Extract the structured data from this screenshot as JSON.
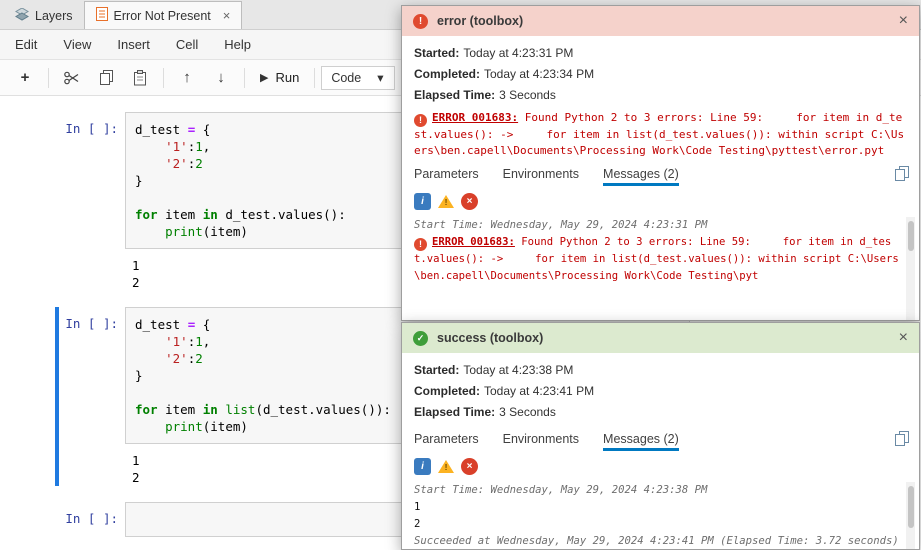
{
  "window": {
    "tabs": [
      {
        "label": "Layers",
        "active": false
      },
      {
        "label": "Error Not Present",
        "active": true
      }
    ]
  },
  "menubar": {
    "items": [
      "Edit",
      "View",
      "Insert",
      "Cell",
      "Help"
    ]
  },
  "toolbar": {
    "add": "+",
    "up": "↑",
    "down": "↓",
    "run_icon": "▶",
    "run_label": "Run",
    "cell_type_value": "Code",
    "caret": "▾"
  },
  "icons": {
    "close": "×",
    "check": "✓",
    "exclamation": "!",
    "info": "i",
    "cross": "×"
  },
  "notebook": {
    "cells": [
      {
        "prompt": "In [ ]:",
        "selected": false,
        "code": [
          [
            [
              "d_test "
            ],
            [
              "=",
              "op"
            ],
            [
              " {"
            ]
          ],
          [
            [
              "    "
            ],
            [
              "'1'",
              "str"
            ],
            [
              ":"
            ],
            [
              "1",
              "num"
            ],
            [
              ","
            ]
          ],
          [
            [
              "    "
            ],
            [
              "'2'",
              "str"
            ],
            [
              ":"
            ],
            [
              "2",
              "num"
            ]
          ],
          [
            [
              "}"
            ]
          ],
          [],
          [
            [
              "for",
              "kw"
            ],
            [
              " item "
            ],
            [
              "in",
              "kw"
            ],
            [
              " d_test.values():"
            ]
          ],
          [
            [
              "    "
            ],
            [
              "print",
              "bi"
            ],
            [
              "(item)"
            ]
          ]
        ],
        "output": [
          "1",
          "2"
        ]
      },
      {
        "prompt": "In [ ]:",
        "selected": true,
        "code": [
          [
            [
              "d_test "
            ],
            [
              "=",
              "op"
            ],
            [
              " {"
            ]
          ],
          [
            [
              "    "
            ],
            [
              "'1'",
              "str"
            ],
            [
              ":"
            ],
            [
              "1",
              "num"
            ],
            [
              ","
            ]
          ],
          [
            [
              "    "
            ],
            [
              "'2'",
              "str"
            ],
            [
              ":"
            ],
            [
              "2",
              "num"
            ]
          ],
          [
            [
              "}"
            ]
          ],
          [],
          [
            [
              "for",
              "kw"
            ],
            [
              " item "
            ],
            [
              "in",
              "kw"
            ],
            [
              " "
            ],
            [
              "list",
              "bi"
            ],
            [
              "(d_test.values()):"
            ]
          ],
          [
            [
              "    "
            ],
            [
              "print",
              "bi"
            ],
            [
              "(item)"
            ]
          ]
        ],
        "output": [
          "1",
          "2"
        ]
      },
      {
        "prompt": "In [ ]:",
        "selected": false,
        "code": [
          []
        ],
        "output": []
      }
    ]
  },
  "labels": {
    "started": "Started:",
    "completed": "Completed:",
    "elapsed": "Elapsed Time:"
  },
  "panels": {
    "error": {
      "title": "error (toolbox)",
      "started": "Today at 4:23:31 PM",
      "completed": "Today at 4:23:34 PM",
      "elapsed": "3 Seconds",
      "banner_code": "ERROR 001683:",
      "banner_text": " Found Python 2 to 3 errors: Line 59:     for item in d_test.values(): ->     for item in list(d_test.values()): within script C:\\Users\\ben.capell\\Documents\\Processing Work\\Code Testing\\pyttest\\error.pyt",
      "tabs": [
        "Parameters",
        "Environments",
        "Messages (2)"
      ],
      "active_tab": "Messages (2)",
      "messages": [
        {
          "kind": "meta",
          "text": "Start Time: Wednesday, May 29, 2024 4:23:31 PM"
        },
        {
          "kind": "error",
          "code": "ERROR 001683:",
          "text": " Found Python 2 to 3 errors: Line 59:     for item in d_test.values(): ->     for item in list(d_test.values()): within script C:\\Users\\ben.capell\\Documents\\Processing Work\\Code Testing\\pyt"
        }
      ]
    },
    "success": {
      "title": "success (toolbox)",
      "started": "Today at 4:23:38 PM",
      "completed": "Today at 4:23:41 PM",
      "elapsed": "3 Seconds",
      "tabs": [
        "Parameters",
        "Environments",
        "Messages (2)"
      ],
      "active_tab": "Messages (2)",
      "messages": [
        {
          "kind": "meta",
          "text": "Start Time: Wednesday, May 29, 2024 4:23:38 PM"
        },
        {
          "kind": "plain",
          "text": "1"
        },
        {
          "kind": "plain",
          "text": "2"
        },
        {
          "kind": "meta",
          "text": "Succeeded at Wednesday, May 29, 2024 4:23:41 PM (Elapsed Time: 3.72 seconds)"
        }
      ]
    }
  }
}
